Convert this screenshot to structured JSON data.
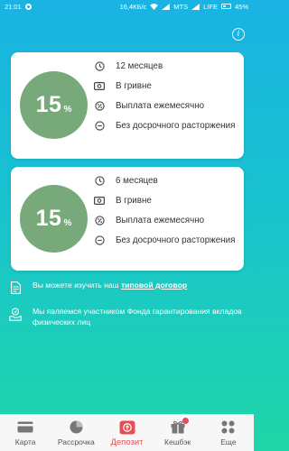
{
  "status_bar": {
    "time": "21:01",
    "speed": "16,4КБ/с",
    "carrier1": "MTS",
    "carrier2": "LIFE",
    "battery": "45%"
  },
  "cards": [
    {
      "rate": "15",
      "rate_unit": "%",
      "term": "12 месяцев",
      "currency": "В гривне",
      "payout": "Выплата ежемесячно",
      "withdrawal": "Без досрочного расторжения"
    },
    {
      "rate": "15",
      "rate_unit": "%",
      "term": "6 месяцев",
      "currency": "В гривне",
      "payout": "Выплата ежемесячно",
      "withdrawal": "Без досрочного расторжения"
    }
  ],
  "notes": {
    "contract_prefix": "Вы можете изучить наш",
    "contract_link": "типовой договор",
    "fund": "Мы являемся участником Фонда гарантирования вкладов физических лиц"
  },
  "tabs": [
    {
      "label": "Карта",
      "icon": "card-icon"
    },
    {
      "label": "Рассрочка",
      "icon": "pie-chart-icon"
    },
    {
      "label": "Депозит",
      "icon": "deposit-icon",
      "active": true
    },
    {
      "label": "Кешбэк",
      "icon": "gift-icon",
      "badge": true
    },
    {
      "label": "Еще",
      "icon": "more-icon"
    }
  ],
  "colors": {
    "accent": "#e84c54",
    "rate_circle": "#78a97b",
    "gradient_top": "#1ab3e3",
    "gradient_bottom": "#1fd6a8"
  }
}
